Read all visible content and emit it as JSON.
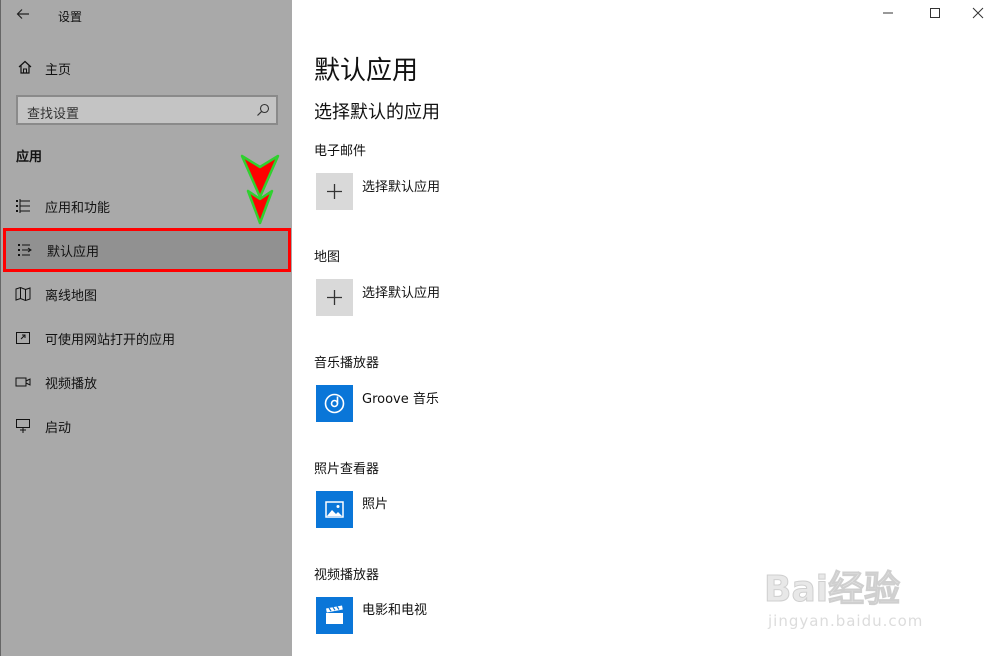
{
  "window": {
    "title": "设置",
    "back_icon": "back-arrow-icon"
  },
  "sidebar": {
    "home": {
      "label": "主页",
      "icon": "home-icon"
    },
    "search": {
      "placeholder": "查找设置",
      "icon": "search-icon"
    },
    "section": "应用",
    "items": [
      {
        "label": "应用和功能",
        "icon": "apps-list-icon",
        "selected": false
      },
      {
        "label": "默认应用",
        "icon": "default-apps-icon",
        "selected": true
      },
      {
        "label": "离线地图",
        "icon": "map-icon",
        "selected": false
      },
      {
        "label": "可使用网站打开的应用",
        "icon": "website-app-icon",
        "selected": false
      },
      {
        "label": "视频播放",
        "icon": "video-icon",
        "selected": false
      },
      {
        "label": "启动",
        "icon": "startup-icon",
        "selected": false
      }
    ]
  },
  "main": {
    "title": "默认应用",
    "subtitle": "选择默认的应用",
    "categories": [
      {
        "label": "电子邮件",
        "app": "选择默认应用",
        "tile": "plus"
      },
      {
        "label": "地图",
        "app": "选择默认应用",
        "tile": "plus"
      },
      {
        "label": "音乐播放器",
        "app": "Groove 音乐",
        "tile": "groove-music"
      },
      {
        "label": "照片查看器",
        "app": "照片",
        "tile": "photos"
      },
      {
        "label": "视频播放器",
        "app": "电影和电视",
        "tile": "movies-tv"
      }
    ]
  },
  "window_controls": {
    "minimize": "minimize-icon",
    "maximize": "maximize-icon",
    "close": "close-icon"
  },
  "watermark": {
    "logo": "Bai经验",
    "url": "jingyan.baidu.com"
  },
  "colors": {
    "sidebar_bg": "#a9a9a9",
    "selected_bg": "#919191",
    "highlight_border": "#ff0000",
    "tile_blue": "#0a76d8",
    "tile_gray": "#d9d9d9",
    "arrow_fill": "#ff0000",
    "arrow_stroke": "#2fd12f"
  }
}
